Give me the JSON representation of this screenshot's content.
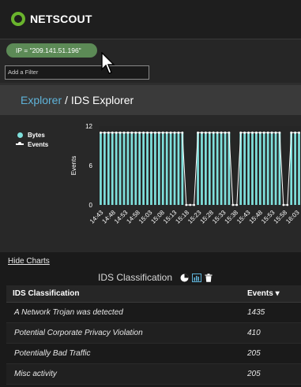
{
  "app": {
    "brand": "NETSCOUT",
    "brand_color": "#6ab42d"
  },
  "filter": {
    "chip_text": "IP = \"209.141.51.196\"",
    "add_placeholder": "Add a Filter"
  },
  "breadcrumb": {
    "parent": "Explorer",
    "separator": " / ",
    "current": "IDS Explorer"
  },
  "chart_data": {
    "type": "bar",
    "title": "",
    "ylabel": "Events",
    "ylim": [
      0,
      12
    ],
    "yticks": [
      0,
      6,
      12
    ],
    "legend": [
      "Bytes",
      "Events"
    ],
    "series": [
      {
        "name": "Bytes",
        "color": "#7fe0dc",
        "values": [
          11,
          11,
          11,
          11,
          11,
          11,
          11,
          11,
          11,
          11,
          11,
          11,
          11,
          11,
          11,
          11,
          11,
          11,
          11,
          11,
          11,
          11,
          0,
          0,
          0,
          11,
          11,
          11,
          11,
          11,
          11,
          11,
          11,
          11,
          0,
          0,
          11,
          11,
          11,
          11,
          11,
          11,
          11,
          11,
          11,
          11,
          11,
          0,
          0,
          11,
          11,
          11
        ]
      },
      {
        "name": "Events",
        "color": "#ffffff",
        "values": [
          11,
          11,
          11,
          11,
          11,
          11,
          11,
          11,
          11,
          11,
          11,
          11,
          11,
          11,
          11,
          11,
          11,
          11,
          11,
          11,
          11,
          11,
          0,
          0,
          0,
          11,
          11,
          11,
          11,
          11,
          11,
          11,
          11,
          11,
          0,
          0,
          11,
          11,
          11,
          11,
          11,
          11,
          11,
          11,
          11,
          11,
          11,
          0,
          0,
          11,
          11,
          11
        ]
      }
    ],
    "xticks": [
      "14:43",
      "14:48",
      "14:53",
      "14:58",
      "15:03",
      "15:08",
      "15:13",
      "15:18",
      "15:23",
      "15:28",
      "15:33",
      "15:38",
      "15:43",
      "15:48",
      "15:53",
      "15:58",
      "16:03"
    ]
  },
  "lower": {
    "hide_charts": "Hide Charts",
    "section_title": "IDS Classification",
    "icons": [
      "pie-chart-icon",
      "bar-chart-icon",
      "trash-icon"
    ]
  },
  "table": {
    "headers": [
      "IDS Classification",
      "Events"
    ],
    "sort_indicator": "▾",
    "rows": [
      {
        "classification": "A Network Trojan was detected",
        "events": "1435"
      },
      {
        "classification": "Potential Corporate Privacy Violation",
        "events": "410"
      },
      {
        "classification": "Potentially Bad Traffic",
        "events": "205"
      },
      {
        "classification": "Misc activity",
        "events": "205"
      }
    ]
  }
}
